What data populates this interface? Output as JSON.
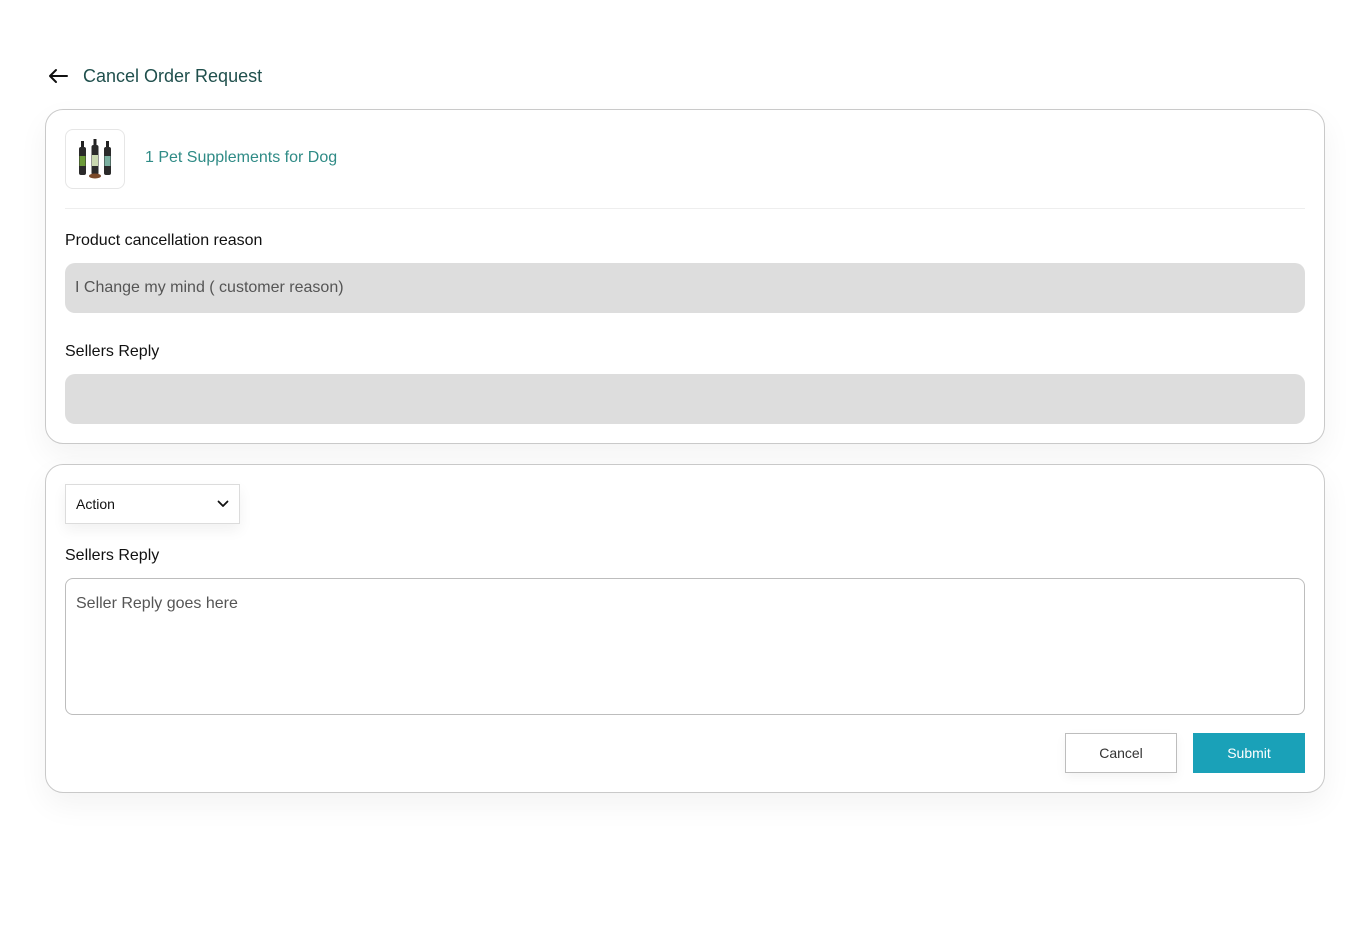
{
  "header": {
    "back_icon": "arrow-left-icon",
    "title": "Cancel Order Request"
  },
  "product": {
    "image_icon": "supplement-bottles-icon",
    "name": "1 Pet Supplements for Dog"
  },
  "cancellation": {
    "label": "Product cancellation reason",
    "value": "I Change my mind ( customer reason)"
  },
  "sellers_reply_readonly": {
    "label": "Sellers Reply",
    "value": ""
  },
  "action_form": {
    "action_select": {
      "selected": "Action",
      "icon": "chevron-down-icon"
    },
    "reply_label": "Sellers Reply",
    "reply_placeholder": "Seller Reply goes here",
    "cancel_label": "Cancel",
    "submit_label": "Submit"
  },
  "colors": {
    "title": "#1f4f4c",
    "product_link": "#2f8b86",
    "readonly_bg": "#dddddd",
    "submit_bg": "#1aa1b8"
  }
}
